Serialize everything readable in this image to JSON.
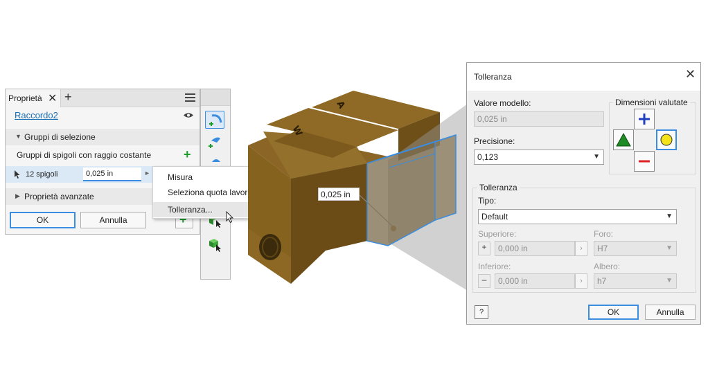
{
  "properties_panel": {
    "tab_label": "Proprietà",
    "feature_name": "Raccordo2",
    "section_selection": "Gruppi di selezione",
    "group_title": "Gruppi di spigoli con raggio costante",
    "edges_label": "12 spigoli",
    "radius_value": "0,025 in",
    "section_advanced": "Proprietà avanzate",
    "ok_label": "OK",
    "cancel_label": "Annulla"
  },
  "context_menu": {
    "items": [
      "Misura",
      "Seleziona quota lavorazione",
      "Tolleranza..."
    ]
  },
  "viewport": {
    "dimension_label": "0,025 in",
    "block_letters": [
      "W",
      "A"
    ]
  },
  "tolerance_dialog": {
    "title": "Tolleranza",
    "model_value_label": "Valore modello:",
    "model_value": "0,025 in",
    "precision_label": "Precisione:",
    "precision_value": "0,123",
    "evaluated_dims_label": "Dimensioni valutate",
    "tolerance_group_label": "Tolleranza",
    "type_label": "Tipo:",
    "type_value": "Default",
    "upper_label": "Superiore:",
    "upper_value": "0,000 in",
    "hole_label": "Foro:",
    "hole_value": "H7",
    "lower_label": "Inferiore:",
    "lower_value": "0,000 in",
    "shaft_label": "Albero:",
    "shaft_value": "h7",
    "help_label": "?",
    "ok_label": "OK",
    "cancel_label": "Annulla"
  },
  "colors": {
    "accent": "#3a8de0",
    "part_face": "#9c7a35",
    "part_side": "#7a5a1c",
    "green": "#1b9e2c",
    "link": "#1a6fb5"
  }
}
